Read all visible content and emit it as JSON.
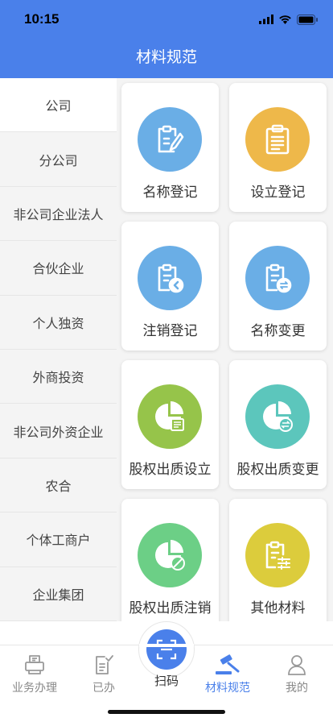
{
  "status": {
    "time": "10:15"
  },
  "header": {
    "title": "材料规范"
  },
  "sidebar": {
    "items": [
      {
        "label": "公司"
      },
      {
        "label": "分公司"
      },
      {
        "label": "非公司企业法人"
      },
      {
        "label": "合伙企业"
      },
      {
        "label": "个人独资"
      },
      {
        "label": "外商投资"
      },
      {
        "label": "非公司外资企业"
      },
      {
        "label": "农合"
      },
      {
        "label": "个体工商户"
      },
      {
        "label": "企业集团"
      }
    ]
  },
  "cards": [
    {
      "label": "名称登记",
      "icon": "clipboard-pen-icon",
      "color": "#6aaee6"
    },
    {
      "label": "设立登记",
      "icon": "clipboard-list-icon",
      "color": "#eeb84a"
    },
    {
      "label": "注销登记",
      "icon": "clipboard-return-icon",
      "color": "#6aaee6"
    },
    {
      "label": "名称变更",
      "icon": "clipboard-swap-icon",
      "color": "#6aaee6"
    },
    {
      "label": "股权出质设立",
      "icon": "pie-doc-icon",
      "color": "#96c44a"
    },
    {
      "label": "股权出质变更",
      "icon": "pie-swap-icon",
      "color": "#5cc6bc"
    },
    {
      "label": "股权出质注销",
      "icon": "pie-cancel-icon",
      "color": "#6ccf86"
    },
    {
      "label": "其他材料",
      "icon": "clipboard-sliders-icon",
      "color": "#dccc3c"
    }
  ],
  "tabbar": {
    "items": [
      {
        "label": "业务办理",
        "icon": "printer-icon"
      },
      {
        "label": "已办",
        "icon": "checked-doc-icon"
      },
      {
        "label": "扫码",
        "icon": "scan-icon"
      },
      {
        "label": "材料规范",
        "icon": "gavel-icon"
      },
      {
        "label": "我的",
        "icon": "user-icon"
      }
    ],
    "active": "材料规范"
  }
}
